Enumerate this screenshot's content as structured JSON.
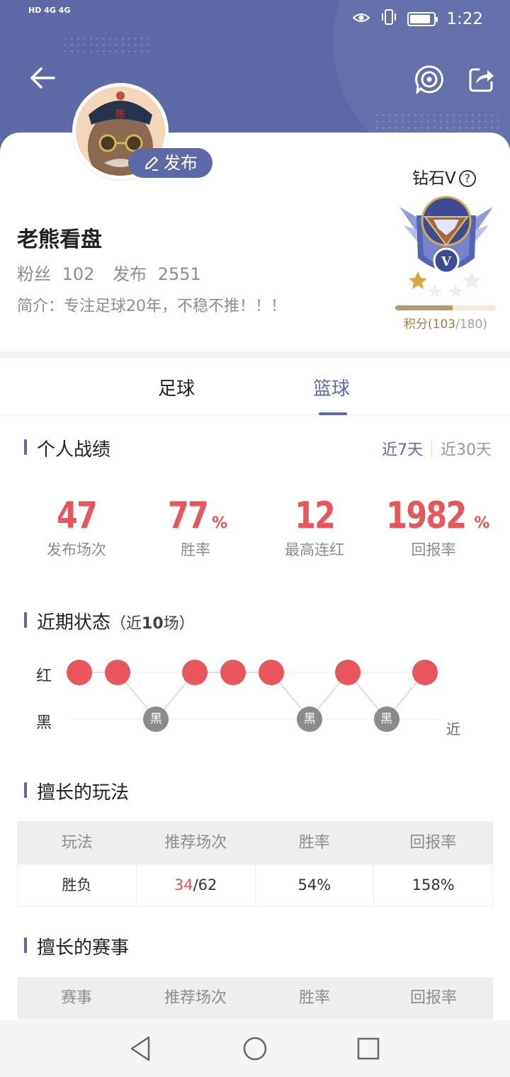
{
  "status_bar": {
    "network_left": "HD 4G 4G",
    "time": "1:22"
  },
  "header": {
    "back_icon": "arrow-left-icon",
    "target_icon": "broadcast-target-icon",
    "share_icon": "share-icon"
  },
  "profile": {
    "publish_label": "发布",
    "name": "老熊看盘",
    "fans_label": "粉丝",
    "fans_count": "102",
    "posts_label": "发布",
    "posts_count": "2551",
    "bio": "简介：专注足球20年，不稳不推！！！",
    "level": "钻石V",
    "help_icon": "?",
    "badge_letter": "V",
    "points_text": "积分(103",
    "points_max": "/180)",
    "points_progress": 0.572
  },
  "tabs": [
    "足球",
    "篮球"
  ],
  "active_tab": 1,
  "record": {
    "title": "个人战绩",
    "period_options": [
      "近7天",
      "近30天"
    ],
    "active_period": 0,
    "stats": [
      {
        "value": "47",
        "unit": "",
        "label": "发布场次"
      },
      {
        "value": "77",
        "unit": "%",
        "label": "胜率"
      },
      {
        "value": "12",
        "unit": "",
        "label": "最高连红"
      },
      {
        "value": "1982",
        "unit": "%",
        "label": "回报率"
      }
    ]
  },
  "recent": {
    "title": "近期状态",
    "subtitle_pre": "（近",
    "subtitle_num": "10",
    "subtitle_post": "场）",
    "red_label": "红",
    "black_label": "黑",
    "near_label": "近",
    "results": [
      "红",
      "红",
      "黑",
      "红",
      "红",
      "红",
      "黑",
      "红",
      "黑",
      "红"
    ]
  },
  "play_styles": {
    "title": "擅长的玩法",
    "columns": [
      "玩法",
      "推荐场次",
      "胜率",
      "回报率"
    ],
    "rows": [
      {
        "type": "胜负",
        "wins": "34",
        "total": "/62",
        "rate": "54%",
        "return": "158%"
      }
    ]
  },
  "events": {
    "title": "擅长的赛事",
    "columns": [
      "赛事",
      "推荐场次",
      "胜率",
      "回报率"
    ]
  },
  "system_nav": [
    "back-triangle-icon",
    "home-circle-icon",
    "recent-square-icon"
  ],
  "colors": {
    "accent": "#5e6aa8",
    "red": "#e8555b",
    "black": "#8b8b8b",
    "gold": "#b99a66"
  }
}
